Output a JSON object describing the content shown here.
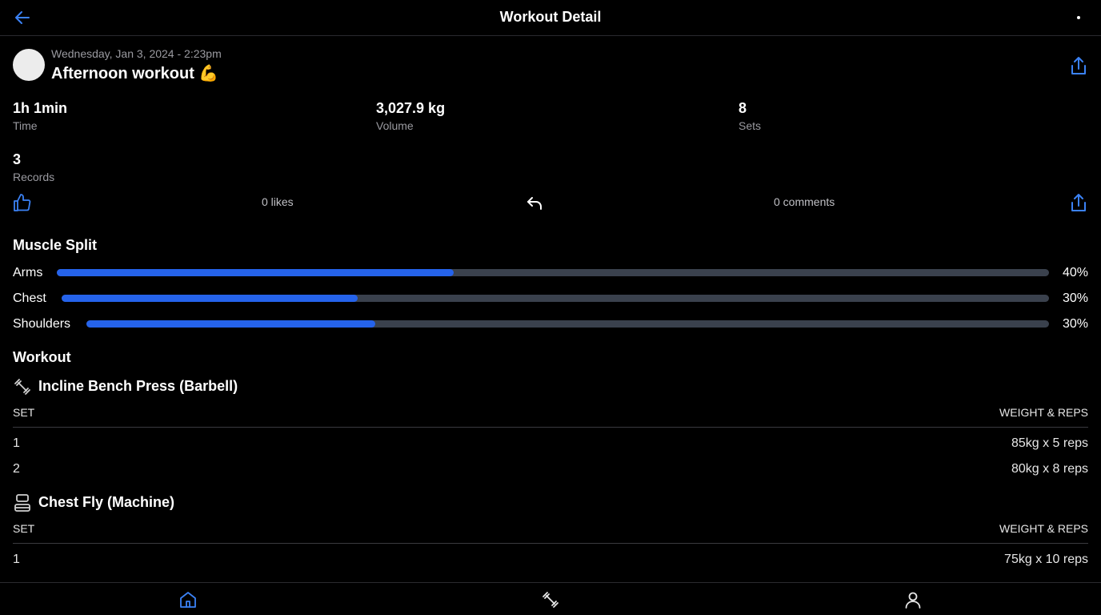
{
  "header": {
    "title": "Workout Detail",
    "back_icon": "arrow-left-icon",
    "menu_icon": "more-dot-icon"
  },
  "workout": {
    "datetime": "Wednesday, Jan 3, 2024 - 2:23pm",
    "title": "Afternoon workout 💪"
  },
  "stats": {
    "time": {
      "value": "1h 1min",
      "label": "Time"
    },
    "volume": {
      "value": "3,027.9 kg",
      "label": "Volume"
    },
    "sets": {
      "value": "8",
      "label": "Sets"
    },
    "records": {
      "value": "3",
      "label": "Records"
    }
  },
  "social": {
    "likes": "0 likes",
    "comments": "0 comments"
  },
  "muscle_split": {
    "title": "Muscle Split",
    "items": [
      {
        "name": "Arms",
        "percent_label": "40%",
        "fill": 0.4
      },
      {
        "name": "Chest",
        "percent_label": "30%",
        "fill": 0.3
      },
      {
        "name": "Shoulders",
        "percent_label": "30%",
        "fill": 0.3
      }
    ]
  },
  "workout_section": {
    "title": "Workout",
    "exercises": [
      {
        "name": "Incline Bench Press (Barbell)",
        "icon": "barbell-icon",
        "col_set": "SET",
        "col_weight_reps": "WEIGHT & REPS",
        "sets": [
          {
            "set": "1",
            "value": "85kg x 5 reps"
          },
          {
            "set": "2",
            "value": "80kg x 8 reps"
          }
        ]
      },
      {
        "name": "Chest Fly (Machine)",
        "icon": "machine-icon",
        "col_set": "SET",
        "col_weight_reps": "WEIGHT & REPS",
        "sets": [
          {
            "set": "1",
            "value": "75kg x 10 reps"
          }
        ]
      }
    ]
  },
  "colors": {
    "accent": "#3b82f6",
    "bar_fill": "#2563eb",
    "bar_track": "#3a414d",
    "background": "#000000"
  },
  "bottom_nav": {
    "items": [
      "home-icon",
      "dumbbell-icon",
      "profile-icon"
    ],
    "active": "home-icon"
  }
}
